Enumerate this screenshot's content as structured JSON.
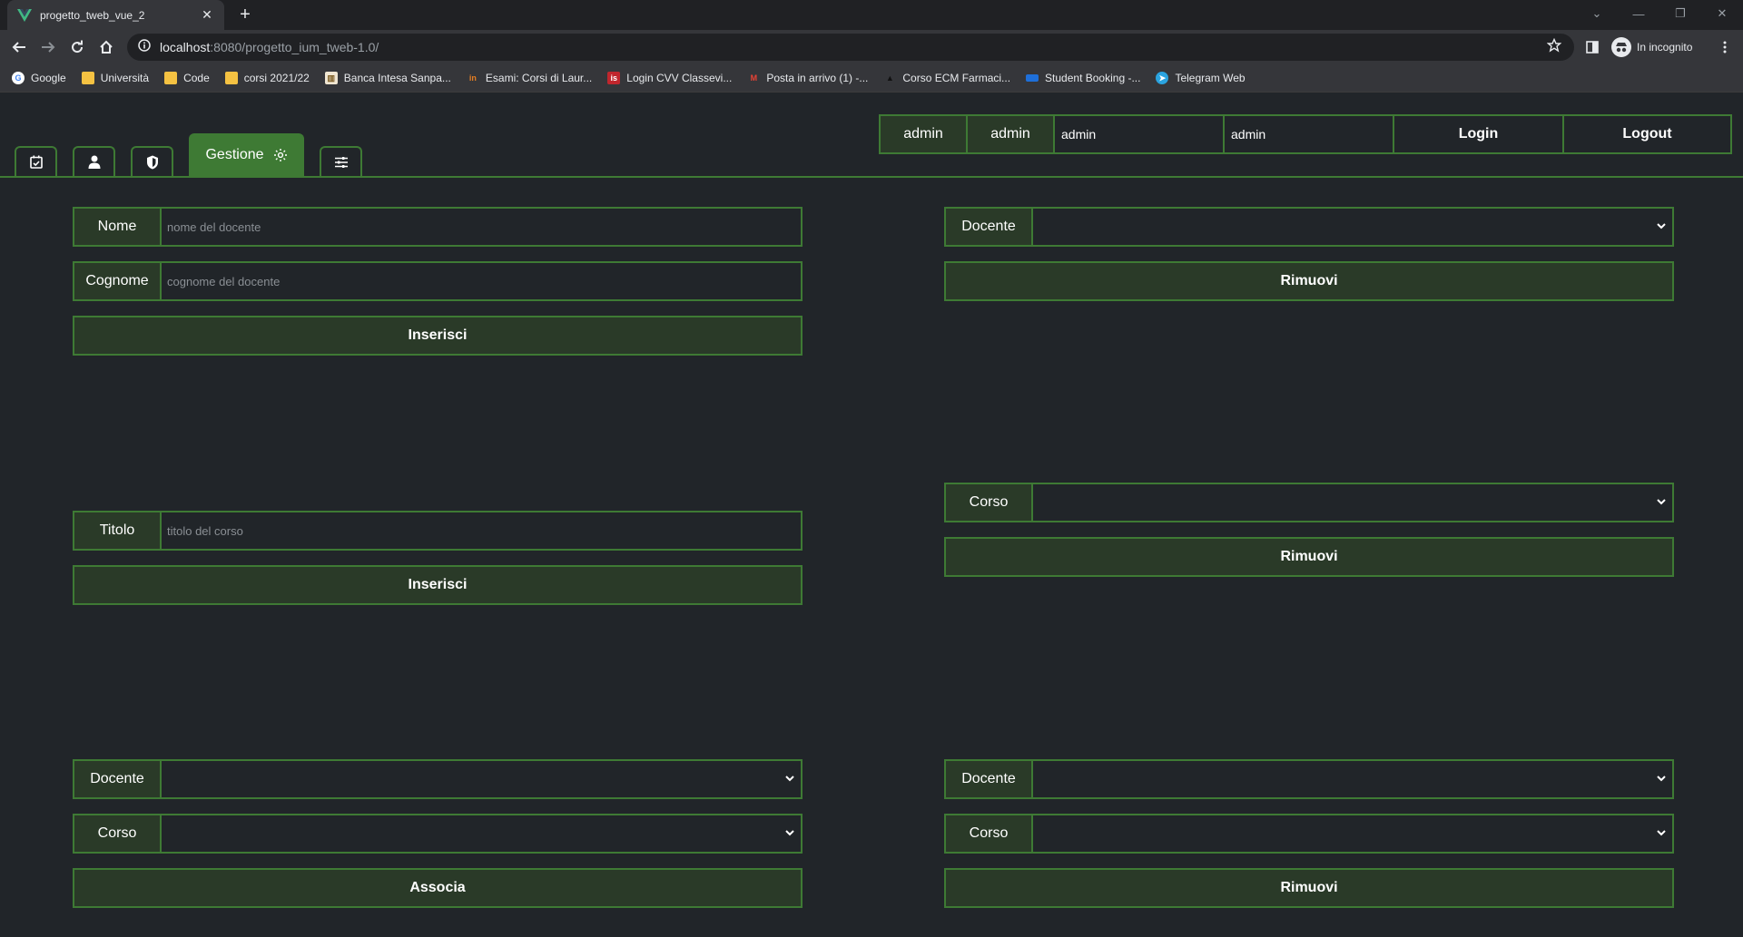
{
  "browser": {
    "tab_title": "progetto_tweb_vue_2",
    "url_host": "localhost",
    "url_path": ":8080/progetto_ium_tweb-1.0/",
    "incognito_label": "In incognito",
    "bookmarks": [
      {
        "label": "Google",
        "icon": "google-icon"
      },
      {
        "label": "Università",
        "icon": "folder-icon"
      },
      {
        "label": "Code",
        "icon": "folder-icon"
      },
      {
        "label": "corsi 2021/22",
        "icon": "folder-icon"
      },
      {
        "label": "Banca Intesa Sanpa...",
        "icon": "bank-icon"
      },
      {
        "label": "Esami: Corsi di Laur...",
        "icon": "unito-icon"
      },
      {
        "label": "Login CVV Classevi...",
        "icon": "cvv-icon"
      },
      {
        "label": "Posta in arrivo (1) -...",
        "icon": "gmail-icon"
      },
      {
        "label": "Corso ECM Farmaci...",
        "icon": "cap-icon"
      },
      {
        "label": "Student Booking -...",
        "icon": "card-icon"
      },
      {
        "label": "Telegram Web",
        "icon": "telegram-icon"
      }
    ]
  },
  "nav": {
    "active_tab_label": "Gestione",
    "colors": {
      "accent": "#3e7a34",
      "background": "#212529"
    }
  },
  "auth": {
    "user_label": "admin",
    "role_label": "admin",
    "username_value": "admin",
    "password_value": "admin",
    "login_label": "Login",
    "logout_label": "Logout"
  },
  "forms": {
    "add_teacher": {
      "name_label": "Nome",
      "name_placeholder": "nome del docente",
      "surname_label": "Cognome",
      "surname_placeholder": "cognome del docente",
      "submit_label": "Inserisci"
    },
    "remove_teacher": {
      "select_label": "Docente",
      "submit_label": "Rimuovi"
    },
    "add_course": {
      "title_label": "Titolo",
      "title_placeholder": "titolo del corso",
      "submit_label": "Inserisci"
    },
    "remove_course": {
      "select_label": "Corso",
      "submit_label": "Rimuovi"
    },
    "associate": {
      "teacher_label": "Docente",
      "course_label": "Corso",
      "submit_label": "Associa"
    },
    "dissociate": {
      "teacher_label": "Docente",
      "course_label": "Corso",
      "submit_label": "Rimuovi"
    }
  }
}
